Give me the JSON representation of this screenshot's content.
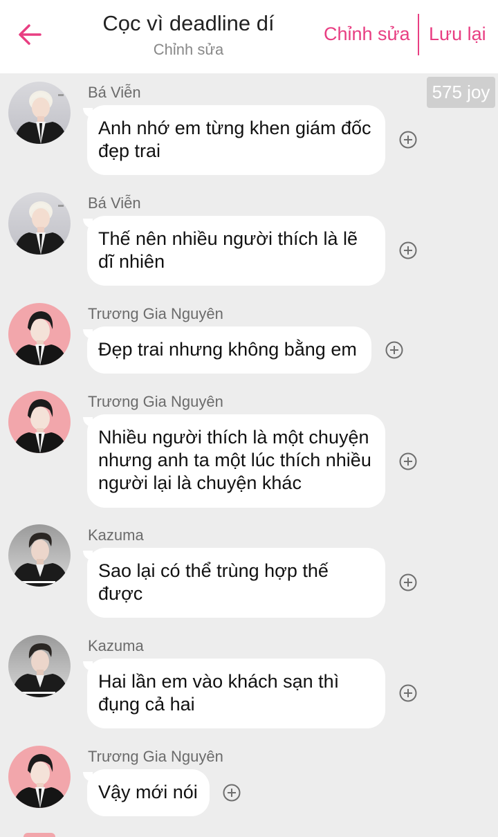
{
  "header": {
    "title": "Cọc vì deadline dí",
    "subtitle": "Chỉnh sửa",
    "edit_label": "Chỉnh sửa",
    "save_label": "Lưu lại",
    "accent_color": "#e83e82"
  },
  "joy_badge": "575 joy",
  "messages": [
    {
      "sender": "Bá Viễn",
      "text": "Anh nhớ em từng khen giám đốc đẹp trai",
      "avatar": "ba-vien-avatar"
    },
    {
      "sender": "Bá Viễn",
      "text": "Thế nên nhiều người thích là lẽ dĩ nhiên",
      "avatar": "ba-vien-avatar"
    },
    {
      "sender": "Trương Gia Nguyên",
      "text": "Đẹp trai nhưng không bằng em",
      "avatar": "truong-gia-nguyen-avatar"
    },
    {
      "sender": "Trương Gia Nguyên",
      "text": "Nhiều người thích là một chuyện nhưng anh ta một lúc thích nhiều người lại là chuyện khác",
      "avatar": "truong-gia-nguyen-avatar"
    },
    {
      "sender": "Kazuma",
      "text": "Sao lại có thể trùng hợp thế được",
      "avatar": "kazuma-avatar"
    },
    {
      "sender": "Kazuma",
      "text": "Hai lần em vào khách sạn thì đụng cả hai",
      "avatar": "kazuma-avatar"
    },
    {
      "sender": "Trương Gia Nguyên",
      "text": "Vậy mới nói",
      "avatar": "truong-gia-nguyen-avatar"
    }
  ]
}
